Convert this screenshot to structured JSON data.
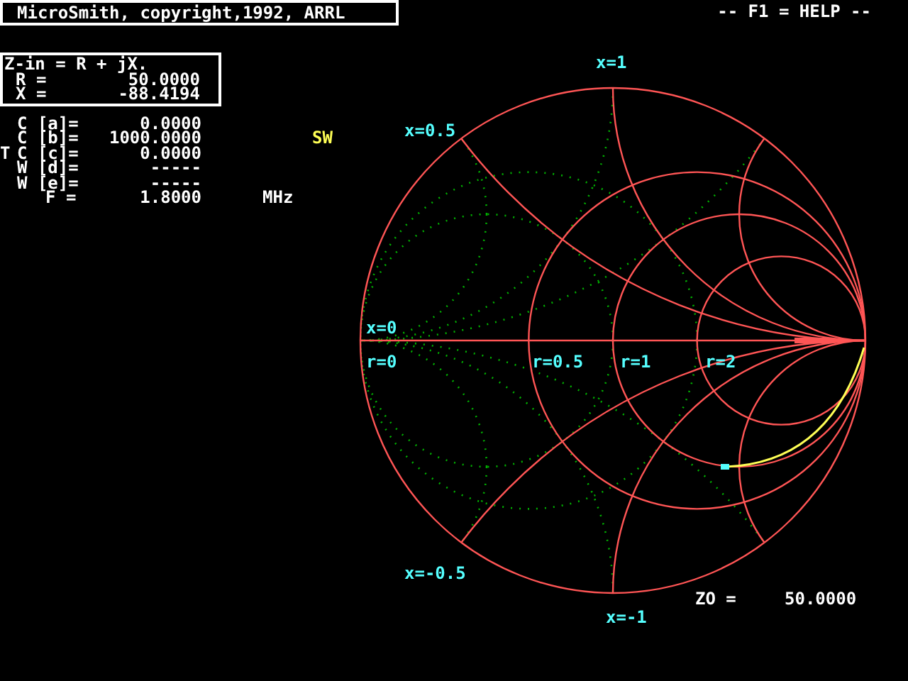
{
  "title": "MicroSmith, copyright,1992, ARRL",
  "help": "-- F1 = HELP --",
  "impedance": {
    "heading": "Z-in = R + jX.",
    "rows": [
      {
        "label": "R =",
        "value": "50.0000"
      },
      {
        "label": "X =",
        "value": "-88.4194"
      }
    ]
  },
  "params": [
    {
      "label": "C [a]=",
      "value": "0.0000"
    },
    {
      "label": "C [b]=",
      "value": "1000.0000",
      "note": "SW"
    },
    {
      "marker": "T",
      "label": "C [c]=",
      "value": "0.0000"
    },
    {
      "label": "W [d]=",
      "value": "-----"
    },
    {
      "label": "W [e]=",
      "value": "-----"
    }
  ],
  "frequency": {
    "label": "F =",
    "value": "1.8000",
    "unit": "MHz"
  },
  "chart_labels": [
    "x=1",
    "x=0.5",
    "x=0",
    "r=0",
    "r=0.5",
    "r=1",
    "r=2",
    "x=-0.5",
    "x=-1"
  ],
  "z0": {
    "label": "ZO =",
    "value": "50.0000"
  }
}
